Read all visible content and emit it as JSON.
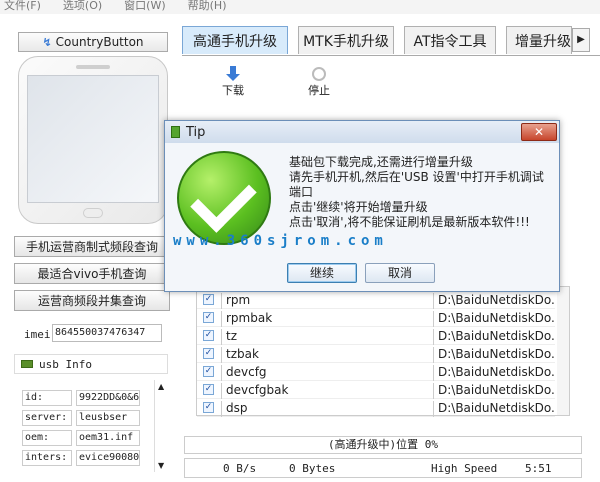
{
  "menu": [
    "文件(F)",
    "选项(O)",
    "窗口(W)",
    "帮助(H)"
  ],
  "left": {
    "country_button": "CountryButton",
    "buttons": [
      "手机运营商制式频段查询",
      "最适合vivo手机查询",
      "运营商频段并集查询"
    ],
    "imei_label": "imei",
    "imei_value": "864550037476347",
    "usb_info_label": "usb Info",
    "info": [
      {
        "key": "id:",
        "value": "9922DD&0&6"
      },
      {
        "key": "server:",
        "value": "leusbser"
      },
      {
        "key": "oem:",
        "value": "oem31.inf"
      },
      {
        "key": "inters:",
        "value": "evice90080"
      }
    ]
  },
  "tabs": [
    "高通手机升级",
    "MTK手机升级",
    "AT指令工具",
    "增量升级"
  ],
  "toolbar": {
    "download": "下载",
    "stop": "停止"
  },
  "files": [
    {
      "name": "rpm",
      "path": "D:\\BaiduNetdiskDo..."
    },
    {
      "name": "rpmbak",
      "path": "D:\\BaiduNetdiskDo..."
    },
    {
      "name": "tz",
      "path": "D:\\BaiduNetdiskDo..."
    },
    {
      "name": "tzbak",
      "path": "D:\\BaiduNetdiskDo..."
    },
    {
      "name": "devcfg",
      "path": "D:\\BaiduNetdiskDo..."
    },
    {
      "name": "devcfgbak",
      "path": "D:\\BaiduNetdiskDo..."
    },
    {
      "name": "dsp",
      "path": "D:\\BaiduNetdiskDo..."
    }
  ],
  "status": {
    "progress_text": "(高通升级中)位置 0%",
    "speed": "0 B/s",
    "bytes": "0 Bytes",
    "mode": "High Speed",
    "time": "5:51"
  },
  "dialog": {
    "title": "Tip",
    "close": "✕",
    "lines": [
      "基础包下载完成,还需进行增量升级",
      "请先手机开机,然后在'USB 设置'中打开手机调试端口",
      "点击'继续'将开始增量升级",
      "点击'取消',将不能保证刷机是最新版本软件!!!"
    ],
    "watermark": "www.360sjrom.com",
    "continue": "继续",
    "cancel": "取消"
  }
}
